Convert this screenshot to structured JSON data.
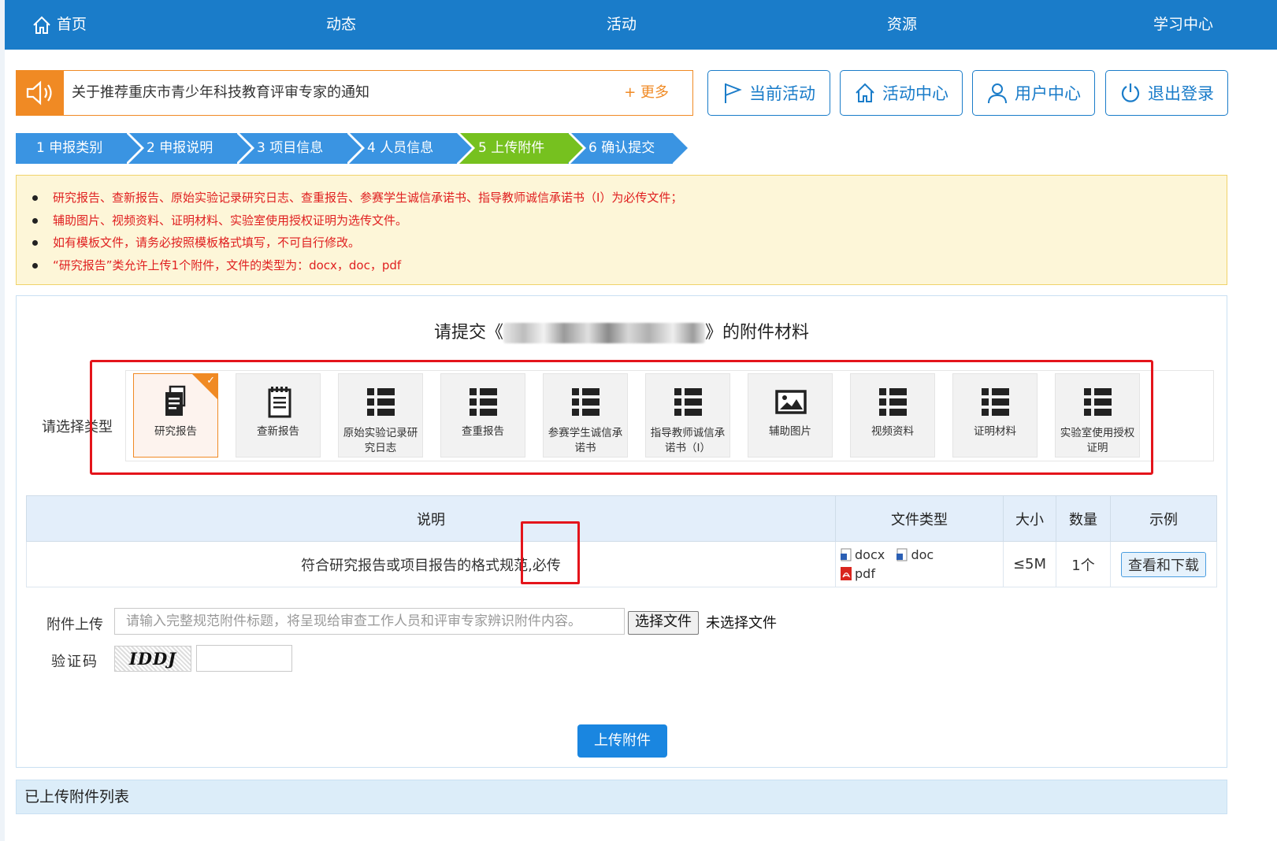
{
  "nav": {
    "home": "首页",
    "news": "动态",
    "activity": "活动",
    "resources": "资源",
    "learning": "学习中心"
  },
  "notice": {
    "text": "关于推荐重庆市青少年科技教育评审专家的通知",
    "more": "+ 更多"
  },
  "quick_buttons": {
    "current": "当前活动",
    "center": "活动中心",
    "user": "用户中心",
    "logout": "退出登录"
  },
  "steps": [
    {
      "label": "1 申报类别",
      "color": "#3a94e2"
    },
    {
      "label": "2 申报说明",
      "color": "#3a94e2"
    },
    {
      "label": "3 项目信息",
      "color": "#3a94e2"
    },
    {
      "label": "4 人员信息",
      "color": "#3a94e2"
    },
    {
      "label": "5 上传附件",
      "color": "#76c11f"
    },
    {
      "label": "6 确认提交",
      "color": "#3a94e2"
    }
  ],
  "tips": [
    "研究报告、查新报告、原始实验记录研究日志、查重报告、参赛学生诚信承诺书、指导教师诚信承诺书（I）为必传文件；",
    "辅助图片、视频资料、证明材料、实验室使用授权证明为选传文件。",
    "如有模板文件，请务必按照模板格式填写，不可自行修改。",
    "“研究报告”类允许上传1个附件，文件的类型为：docx，doc，pdf"
  ],
  "panel": {
    "title_prefix": "请提交《",
    "title_suffix": "》的附件材料",
    "type_label": "请选择类型"
  },
  "types": [
    {
      "label": "研究报告",
      "icon": "document-icon",
      "selected": true
    },
    {
      "label": "查新报告",
      "icon": "notepad-icon",
      "selected": false
    },
    {
      "label": "原始实验记录研究日志",
      "icon": "list-icon",
      "selected": false
    },
    {
      "label": "查重报告",
      "icon": "list-icon",
      "selected": false
    },
    {
      "label": "参赛学生诚信承诺书",
      "icon": "list-icon",
      "selected": false
    },
    {
      "label": "指导教师诚信承诺书（I）",
      "icon": "list-icon",
      "selected": false
    },
    {
      "label": "辅助图片",
      "icon": "image-icon",
      "selected": false
    },
    {
      "label": "视频资料",
      "icon": "list-icon",
      "selected": false
    },
    {
      "label": "证明材料",
      "icon": "list-icon",
      "selected": false
    },
    {
      "label": "实验室使用授权证明",
      "icon": "list-icon",
      "selected": false
    }
  ],
  "table": {
    "headers": [
      "说明",
      "文件类型",
      "大小",
      "数量",
      "示例"
    ],
    "row": {
      "desc": "符合研究报告或项目报告的格式规范,必传",
      "ft1": "docx",
      "ft2": "doc",
      "ft3": "pdf",
      "size": "≤5M",
      "count": "1个",
      "example": "查看和下载"
    }
  },
  "upload": {
    "label": "附件上传",
    "placeholder": "请输入完整规范附件标题，将呈现给审查工作人员和评审专家辨识附件内容。",
    "choose": "选择文件",
    "nofile": "未选择文件",
    "captcha_label": "验证码",
    "captcha_text": "IDDJ",
    "submit": "上传附件"
  },
  "uploaded_list": "已上传附件列表",
  "colors": {
    "nav_bg": "#1a7cc9",
    "accent_orange": "#f08a24",
    "step_blue": "#3a94e2",
    "step_green": "#76c11f",
    "tip_red": "#e02020",
    "highlight_red": "#e4141b"
  }
}
